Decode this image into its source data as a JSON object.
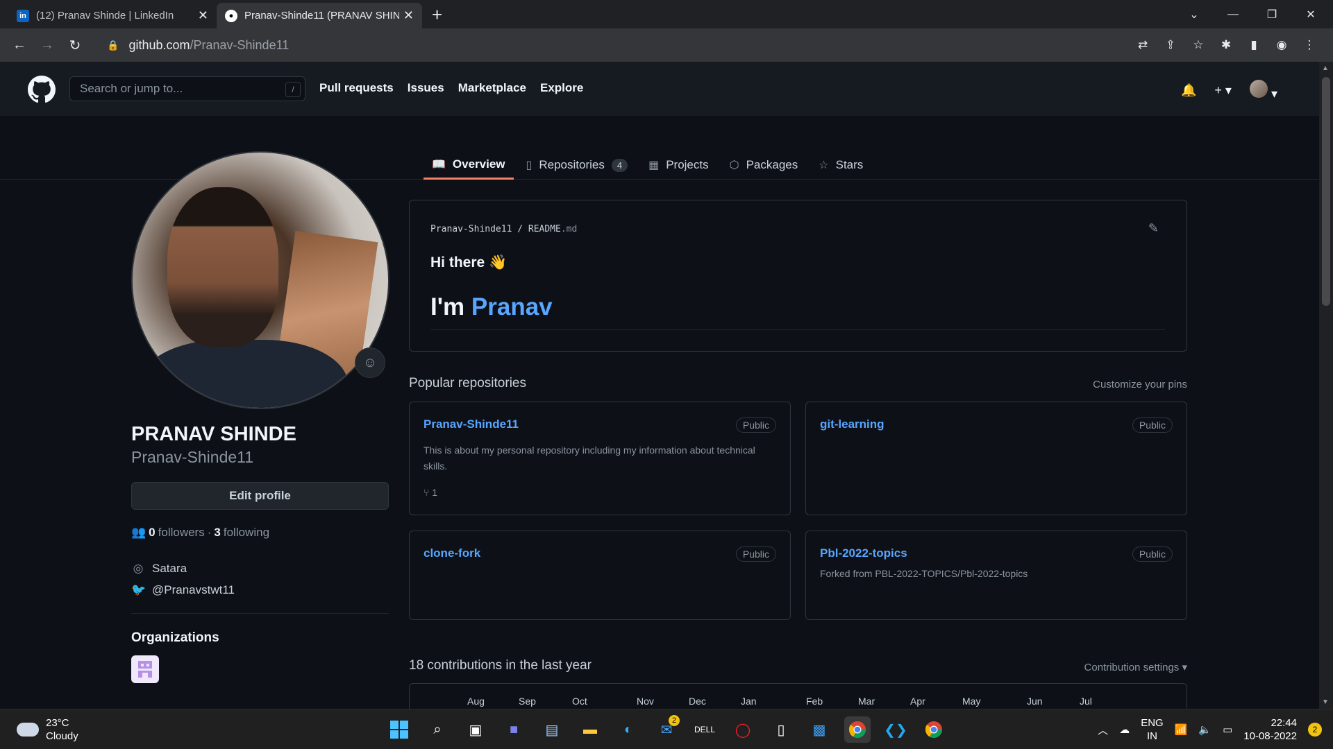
{
  "browser": {
    "tabs": [
      {
        "title": "(12) Pranav Shinde | LinkedIn",
        "favicon": "linkedin-icon"
      },
      {
        "title": "Pranav-Shinde11 (PRANAV SHINDE)",
        "favicon": "github-icon"
      }
    ],
    "url_host": "github.com",
    "url_path": "/Pranav-Shinde11"
  },
  "header": {
    "search_placeholder": "Search or jump to...",
    "search_shortcut": "/",
    "nav": [
      "Pull requests",
      "Issues",
      "Marketplace",
      "Explore"
    ]
  },
  "profile_nav": [
    {
      "label": "Overview",
      "icon": "book-icon"
    },
    {
      "label": "Repositories",
      "icon": "repo-icon",
      "count": "4"
    },
    {
      "label": "Projects",
      "icon": "table-icon"
    },
    {
      "label": "Packages",
      "icon": "package-icon"
    },
    {
      "label": "Stars",
      "icon": "star-icon"
    }
  ],
  "profile": {
    "full_name": "PRANAV SHINDE",
    "username": "Pranav-Shinde11",
    "edit_label": "Edit profile",
    "followers_count": "0",
    "followers_label": "followers",
    "following_count": "3",
    "following_label": "following",
    "location": "Satara",
    "twitter": "@Pranavstwt11",
    "organizations_title": "Organizations"
  },
  "readme": {
    "owner": "Pranav-Shinde11",
    "file": "README",
    "ext": ".md",
    "greeting": "Hi there",
    "greeting_emoji": "👋",
    "im_prefix": "I'm",
    "im_name": "Pranav"
  },
  "popular": {
    "title": "Popular repositories",
    "customize": "Customize your pins",
    "repos": [
      {
        "name": "Pranav-Shinde11",
        "visibility": "Public",
        "description": "This is about my personal repository including my information about technical skills.",
        "forks": "1"
      },
      {
        "name": "git-learning",
        "visibility": "Public",
        "description": ""
      },
      {
        "name": "clone-fork",
        "visibility": "Public",
        "description": ""
      },
      {
        "name": "Pbl-2022-topics",
        "visibility": "Public",
        "description": "Forked from PBL-2022-TOPICS/Pbl-2022-topics"
      }
    ]
  },
  "contributions": {
    "title": "18 contributions in the last year",
    "settings": "Contribution settings",
    "months": [
      "Aug",
      "Sep",
      "Oct",
      "Nov",
      "Dec",
      "Jan",
      "Feb",
      "Mar",
      "Apr",
      "May",
      "Jun",
      "Jul"
    ]
  },
  "taskbar": {
    "temp": "23°C",
    "weather": "Cloudy",
    "mail_badge": "2",
    "lang_top": "ENG",
    "lang_bottom": "IN",
    "time": "22:44",
    "date": "10-08-2022",
    "notif_count": "2"
  }
}
